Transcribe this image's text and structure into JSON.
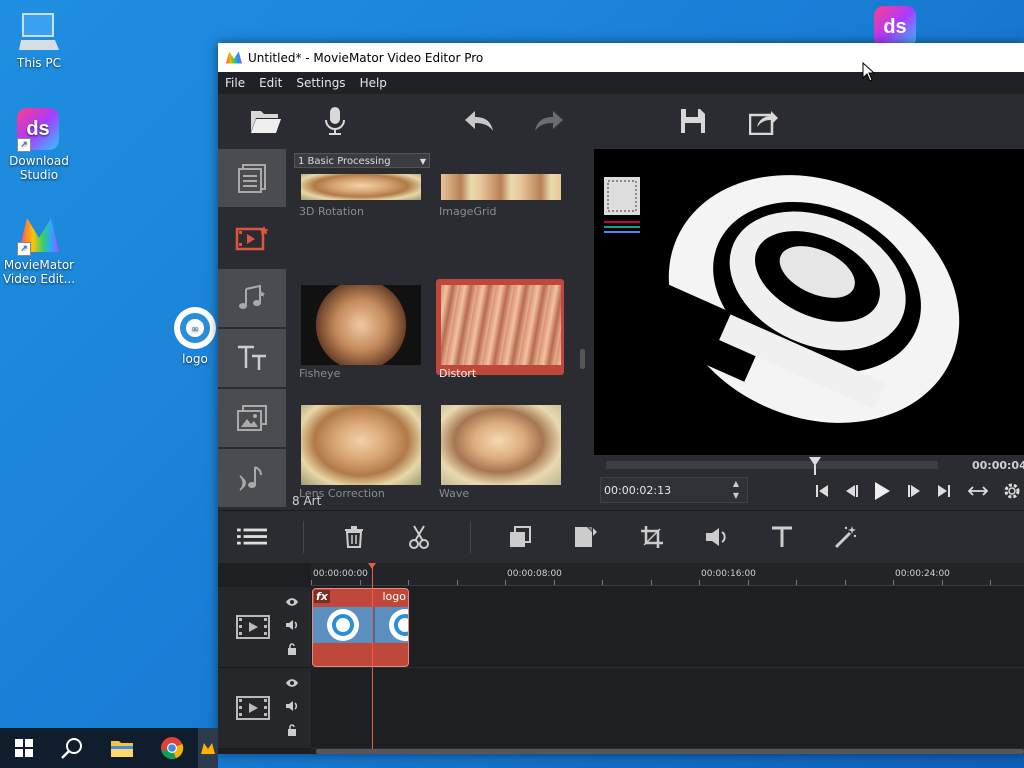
{
  "desktop": {
    "icons": [
      {
        "label": "This PC"
      },
      {
        "label": "Download Studio"
      },
      {
        "label": "MovieMator Video Edit..."
      },
      {
        "label": "logo"
      }
    ],
    "corner_logo_text": "ds"
  },
  "window": {
    "title": "Untitled* - MovieMator Video Editor Pro",
    "menu": [
      "File",
      "Edit",
      "Settings",
      "Help"
    ],
    "toolbar": [
      "open-folder-icon",
      "microphone-icon",
      "undo-icon",
      "redo-icon",
      "save-icon",
      "export-icon"
    ]
  },
  "effects": {
    "category_select": "1 Basic Processing",
    "items": [
      {
        "label": "3D Rotation"
      },
      {
        "label": "ImageGrid"
      },
      {
        "label": "Fisheye"
      },
      {
        "label": "Distort",
        "selected": true
      },
      {
        "label": "Lens Correction"
      },
      {
        "label": "Wave"
      }
    ],
    "next_group": "8 Art"
  },
  "player": {
    "duration": "00:00:04:",
    "timecode": "00:00:02:13",
    "progress": 0.63
  },
  "timeline": {
    "ruler": [
      "00:00:00:00",
      "00:00:08:00",
      "00:00:16:00",
      "00:00:24:00"
    ],
    "clip": {
      "fx": "fx",
      "name": "logo"
    }
  },
  "colors": {
    "accent": "#c0483a",
    "panel": "#2a2c31",
    "playhead": "#e85a4a"
  }
}
